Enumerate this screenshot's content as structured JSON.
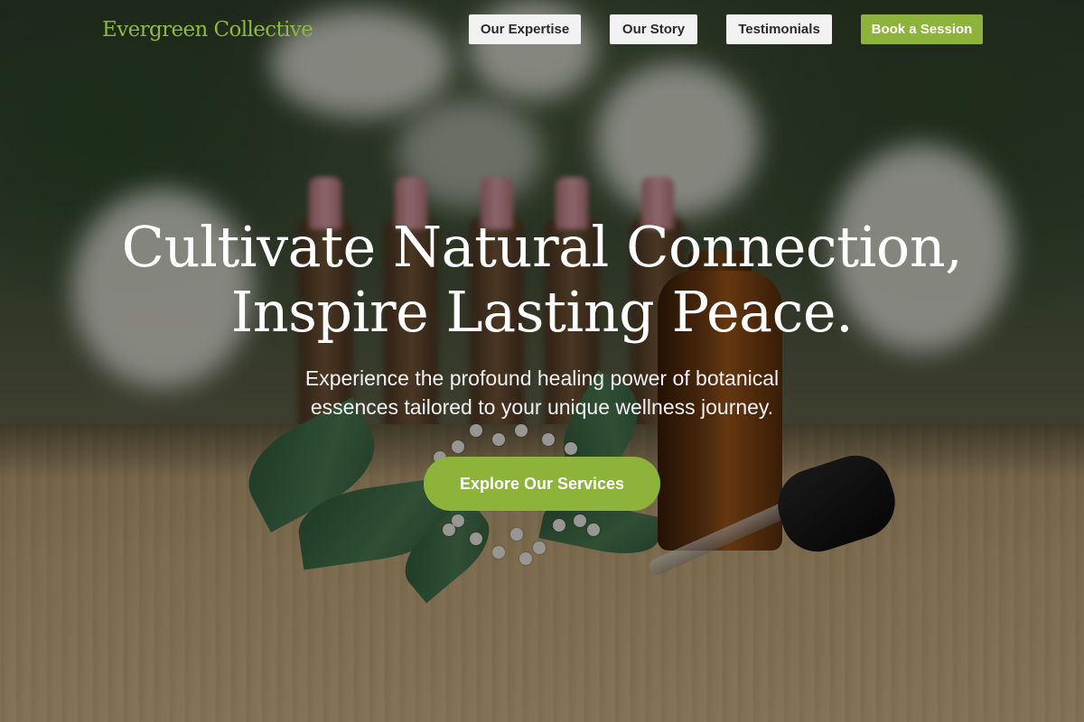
{
  "brand": {
    "name": "Evergreen Collective",
    "accent_color": "#8db33b"
  },
  "nav": {
    "items": [
      {
        "label": "Our Expertise"
      },
      {
        "label": "Our Story"
      },
      {
        "label": "Testimonials"
      }
    ],
    "cta_label": "Book a Session"
  },
  "hero": {
    "headline_line1": "Cultivate Natural Connection,",
    "headline_line2": "Inspire Lasting Peace.",
    "subhead_line1": "Experience the profound healing power of botanical",
    "subhead_line2": "essences tailored to your unique wellness journey.",
    "cta_label": "Explore Our Services",
    "background_image": "photo of amber dropper bottle, white flowers and leaves on wooden table with blurred bottles behind"
  }
}
